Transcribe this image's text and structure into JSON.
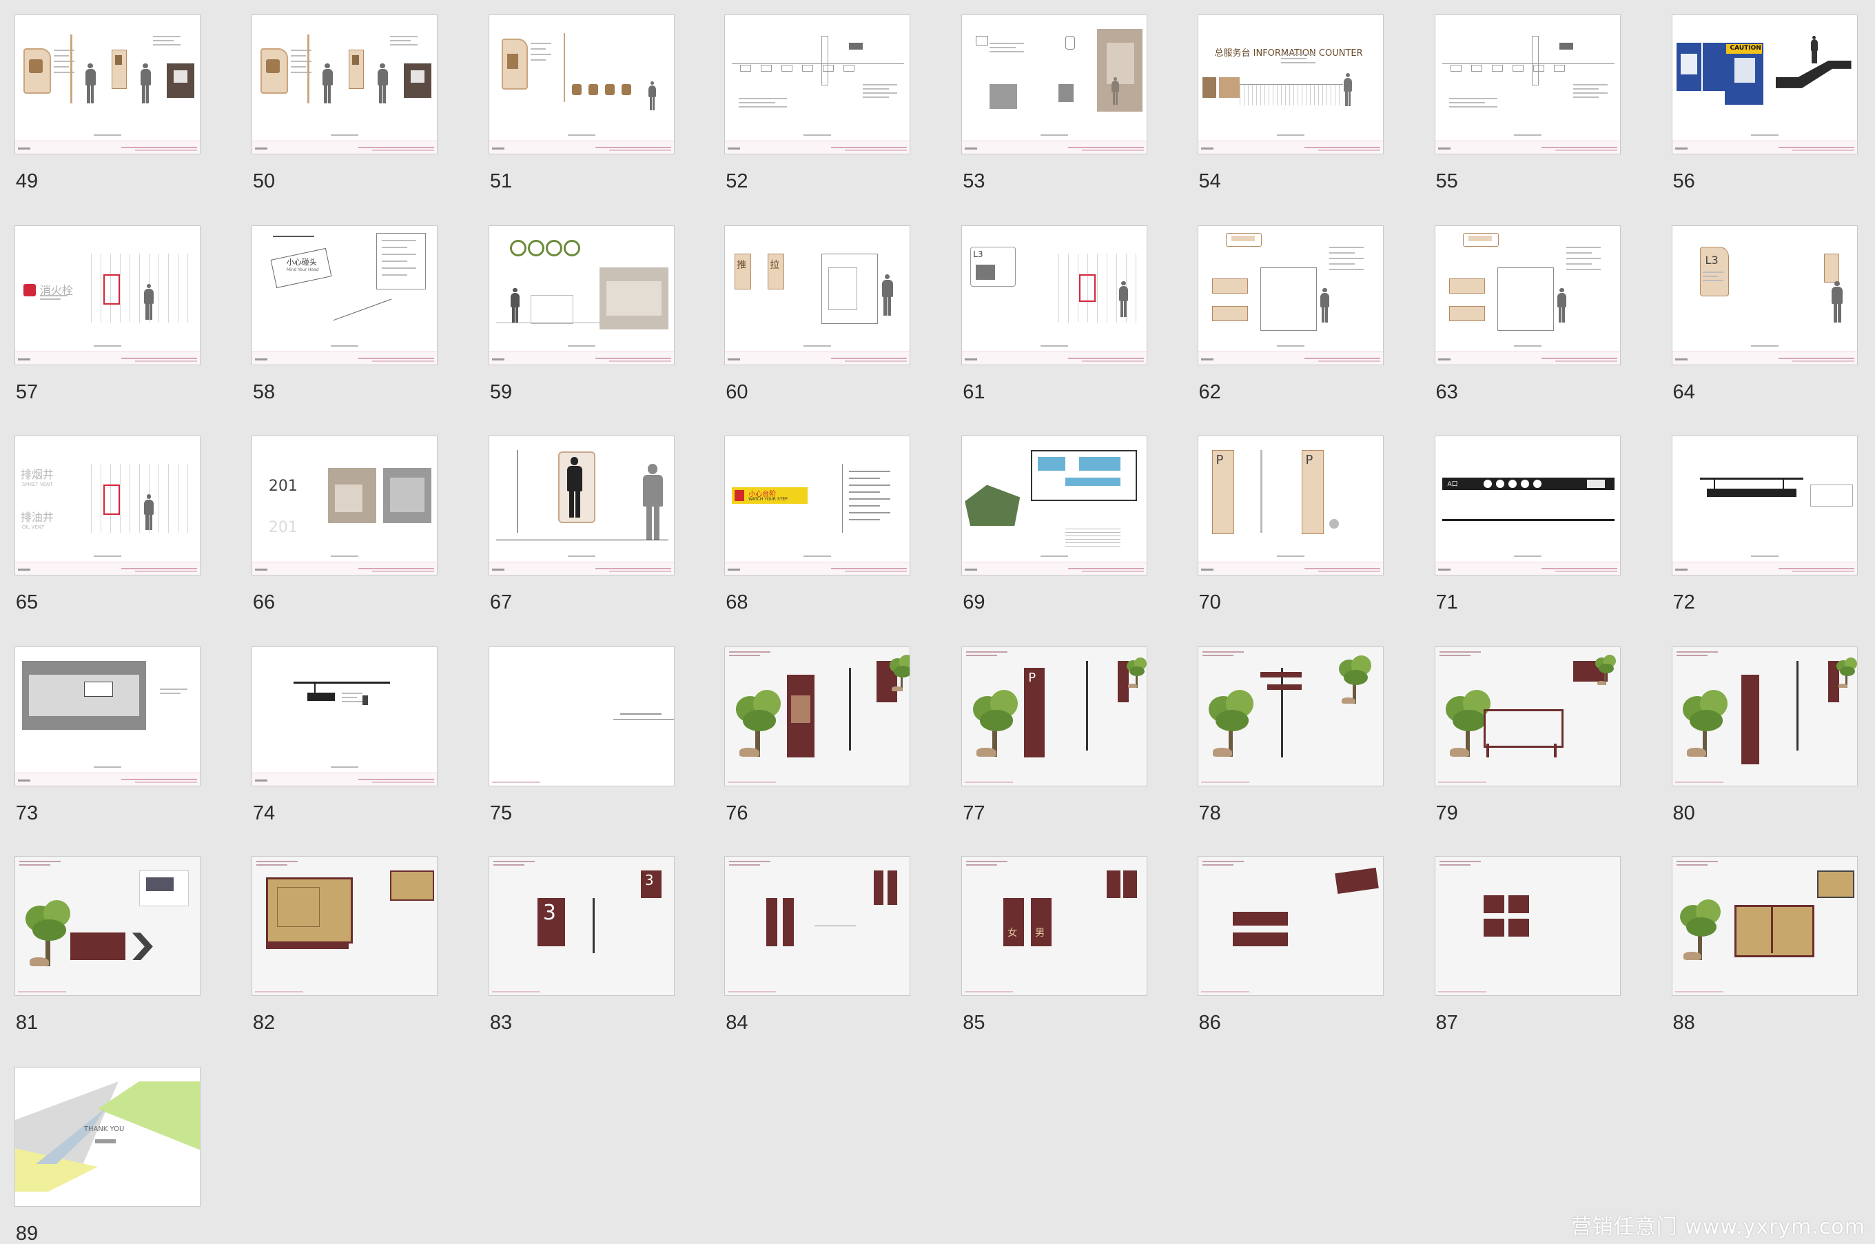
{
  "slides": [
    {
      "number": "49",
      "kind": "restroom-sign-wood"
    },
    {
      "number": "50",
      "kind": "restroom-sign-wood"
    },
    {
      "number": "51",
      "kind": "restroom-icons"
    },
    {
      "number": "52",
      "kind": "line-drawing"
    },
    {
      "number": "53",
      "kind": "signs-photos"
    },
    {
      "number": "54",
      "kind": "info-counter",
      "title": "总服务台 INFORMATION COUNTER"
    },
    {
      "number": "55",
      "kind": "line-drawing"
    },
    {
      "number": "56",
      "kind": "caution-panels",
      "label": "CAUTION"
    },
    {
      "number": "57",
      "kind": "fire-hydrant",
      "title": "消火栓"
    },
    {
      "number": "58",
      "kind": "mind-head",
      "title": "小心碰头",
      "subtitle": "Mind Your Head"
    },
    {
      "number": "59",
      "kind": "prohibition-icons"
    },
    {
      "number": "60",
      "kind": "door-signs",
      "a": "推",
      "b": "拉"
    },
    {
      "number": "61",
      "kind": "floor-guide",
      "label": "L3"
    },
    {
      "number": "62",
      "kind": "room-signs"
    },
    {
      "number": "63",
      "kind": "room-signs"
    },
    {
      "number": "64",
      "kind": "floor-sign",
      "label": "L3"
    },
    {
      "number": "65",
      "kind": "vent-signs",
      "a": "排烟井",
      "a_en": "SMKET VENT",
      "b": "排油井",
      "b_en": "OIL VENT"
    },
    {
      "number": "66",
      "kind": "room-number",
      "label": "201"
    },
    {
      "number": "67",
      "kind": "mirror-figure"
    },
    {
      "number": "68",
      "kind": "watch-step",
      "title": "小心台阶",
      "subtitle": "WATCH YOUR STEP"
    },
    {
      "number": "69",
      "kind": "floor-plan"
    },
    {
      "number": "70",
      "kind": "parking-posts",
      "label": "P"
    },
    {
      "number": "71",
      "kind": "black-banner",
      "label": "A口"
    },
    {
      "number": "72",
      "kind": "hanging-sign"
    },
    {
      "number": "73",
      "kind": "parking-photo"
    },
    {
      "number": "74",
      "kind": "hanging-sign-small"
    },
    {
      "number": "75",
      "kind": "section-title"
    },
    {
      "number": "76",
      "kind": "outdoor-totem"
    },
    {
      "number": "77",
      "kind": "outdoor-parking",
      "label": "P"
    },
    {
      "number": "78",
      "kind": "outdoor-direction"
    },
    {
      "number": "79",
      "kind": "outdoor-board"
    },
    {
      "number": "80",
      "kind": "outdoor-post"
    },
    {
      "number": "81",
      "kind": "outdoor-arrow"
    },
    {
      "number": "82",
      "kind": "map-board"
    },
    {
      "number": "83",
      "kind": "building-number",
      "label": "3"
    },
    {
      "number": "84",
      "kind": "door-plaques"
    },
    {
      "number": "85",
      "kind": "toilet-signs",
      "a": "女",
      "b": "男"
    },
    {
      "number": "86",
      "kind": "warning-plaques"
    },
    {
      "number": "87",
      "kind": "warning-tiles"
    },
    {
      "number": "88",
      "kind": "trash-bins"
    },
    {
      "number": "89",
      "kind": "thank-you",
      "title": "THANK YOU"
    }
  ],
  "watermark": "营销任意门 www.yxrym.com",
  "colors": {
    "background": "#e7e7e7",
    "brown": "#6b2d2d",
    "wood": "#e9d3b9",
    "footer_pink": "#d9a7b4"
  }
}
